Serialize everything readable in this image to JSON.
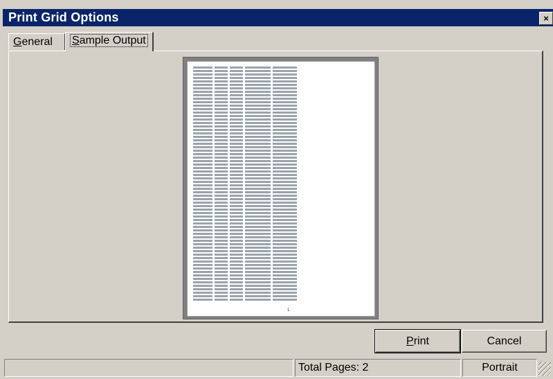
{
  "dialog": {
    "title": "Print Grid Options",
    "close_glyph": "×"
  },
  "tabs": {
    "general": "General",
    "general_accel": "G",
    "general_rest": "eneral",
    "sample": "Sample Output",
    "sample_accel": "S",
    "sample_rest": "ample Output"
  },
  "preview": {
    "page_number": "1"
  },
  "buttons": {
    "print": "Print",
    "print_accel": "P",
    "print_rest": "rint",
    "cancel": "Cancel"
  },
  "status": {
    "left": "",
    "total_pages": "Total Pages: 2",
    "orientation": "Portrait"
  }
}
